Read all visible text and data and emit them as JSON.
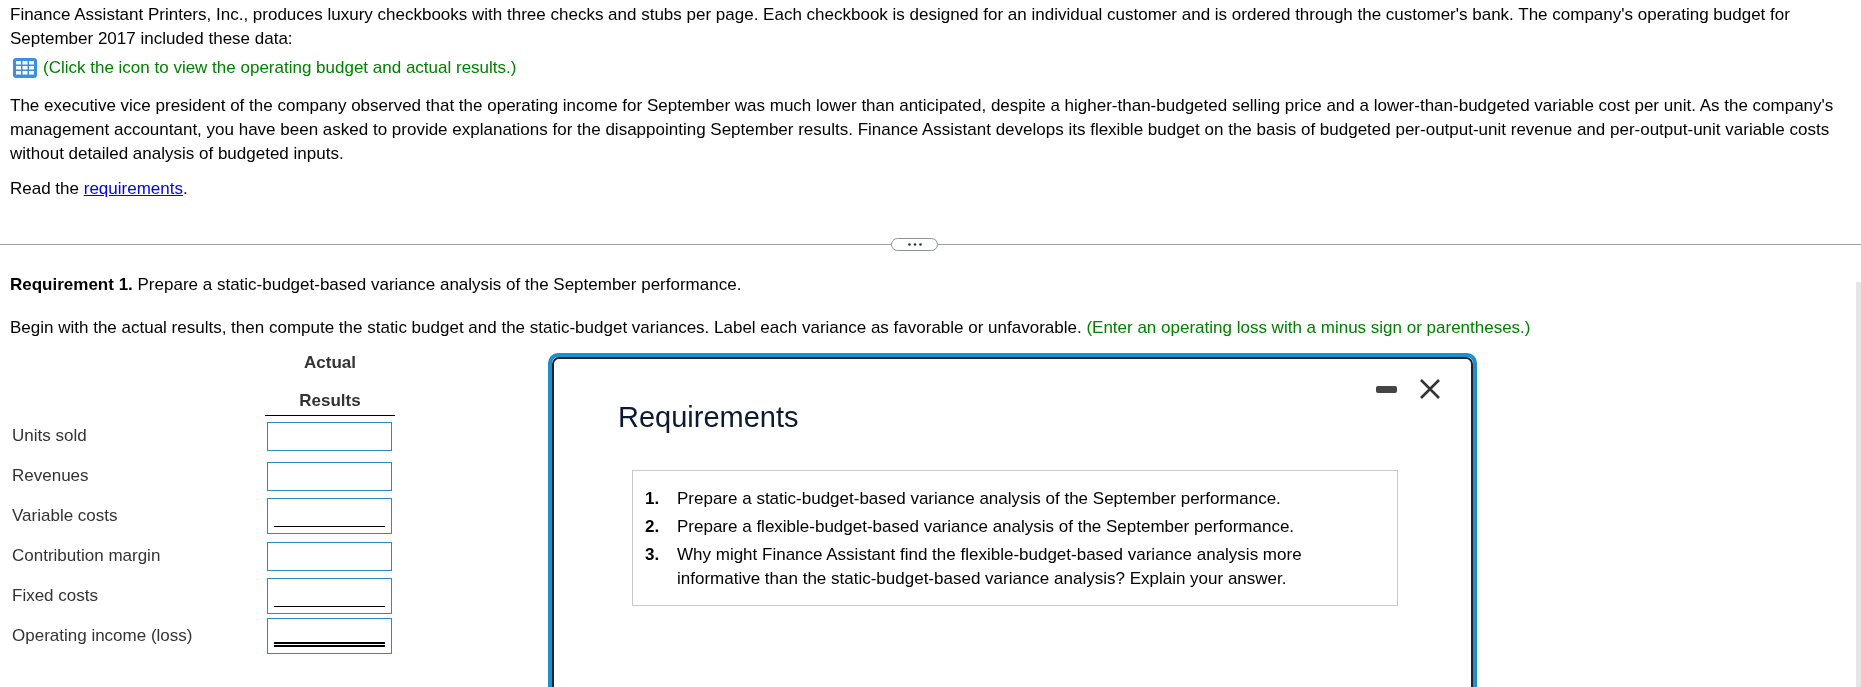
{
  "intro": {
    "paragraph_1": "Finance Assistant Printers, Inc., produces luxury checkbooks with three checks and stubs per page. Each checkbook is designed for an individual customer and is ordered through the customer's bank. The company's operating budget for September 2017 included these data:",
    "data_link": "(Click the icon to view the operating budget and actual results.)",
    "paragraph_2": "The executive vice president of the company observed that the operating income for September was much lower than anticipated, despite a higher-than-budgeted selling price and a lower-than-budgeted variable cost per unit. As the company's management accountant, you have been asked to provide explanations for the disappointing September results. Finance Assistant develops its flexible budget on the basis of budgeted per-output-unit revenue and per-output-unit variable costs without detailed analysis of budgeted inputs.",
    "read_prefix": "Read the ",
    "read_link": "requirements",
    "read_suffix": "."
  },
  "requirement": "**Requirement 1.** Prepare a static-budget-based variance analysis of the September performance.",
  "instructions": "Begin with the actual results, then compute the static budget and the static-budget variances. Label each variance as favorable or unfavorable.",
  "hint": "(Enter an operating loss with a minus sign or parentheses.)",
  "table": {
    "header_lines": [
      "Actual",
      "Results"
    ],
    "rows": [
      {
        "label": "Units sold",
        "kind": "plain"
      },
      {
        "label": "Revenues",
        "kind": "plain"
      },
      {
        "label": "Variable costs",
        "kind": "single"
      },
      {
        "label": "Contribution margin",
        "kind": "plain"
      },
      {
        "label": "Fixed costs",
        "kind": "single"
      },
      {
        "label": "Operating income (loss)",
        "kind": "double"
      }
    ]
  },
  "modal": {
    "title": "Requirements",
    "items": [
      {
        "number": "1.",
        "text": "Prepare a static-budget-based variance analysis of the September performance."
      },
      {
        "number": "2.",
        "text": "Prepare a flexible-budget-based variance analysis of the September performance."
      },
      {
        "number": "3.",
        "text": "Why might Finance Assistant find the flexible-budget-based variance analysis more informative than the static-budget-based variance analysis? Explain your answer."
      }
    ]
  }
}
